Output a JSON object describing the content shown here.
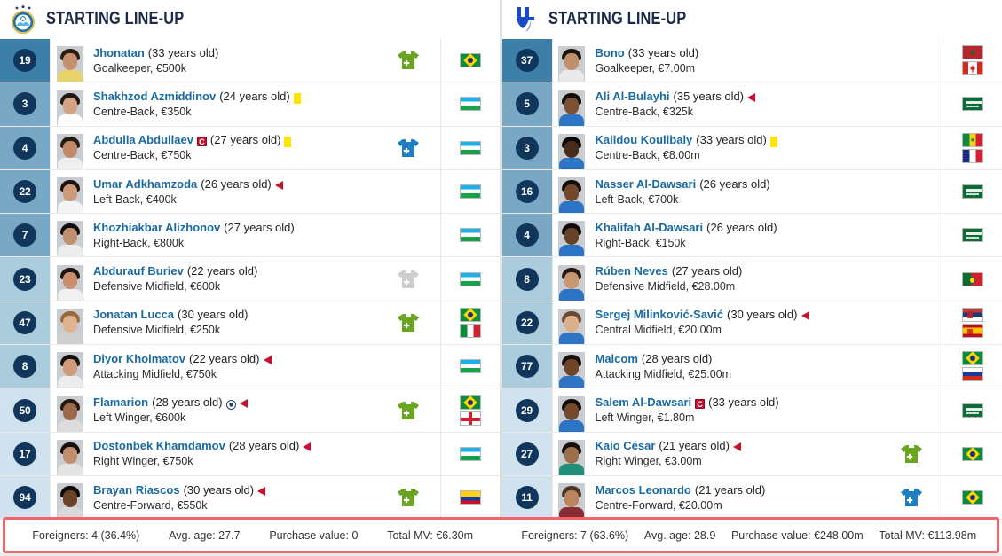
{
  "panels": [
    {
      "team_id": "pakhtakor",
      "logo": "pakhtakor-crest-icon",
      "title": "STARTING LINE-UP",
      "players": [
        {
          "number": "19",
          "name": "Jhonatan",
          "age": "(33 years old)",
          "position_value": "Goalkeeper, €500k",
          "captain": false,
          "yellow_card": false,
          "sub_off": false,
          "goal": false,
          "sub_icon": "sub-on-green",
          "flags": [
            "brazil"
          ],
          "tier": "gk",
          "photo": {
            "hair": "#2b1c12",
            "face": "#c79071",
            "body": "#e8d36a"
          }
        },
        {
          "number": "3",
          "name": "Shakhzod Azmiddinov",
          "age": "(24 years old)",
          "position_value": "Centre-Back, €350k",
          "captain": false,
          "yellow_card": true,
          "sub_off": false,
          "goal": false,
          "sub_icon": "none",
          "flags": [
            "uzbekistan"
          ],
          "tier": "def",
          "photo": {
            "hair": "#1d1611",
            "face": "#d4a184",
            "body": "#ffffff"
          }
        },
        {
          "number": "4",
          "name": "Abdulla Abdullaev",
          "age": "(27 years old)",
          "position_value": "Centre-Back, €750k",
          "captain": true,
          "yellow_card": true,
          "sub_off": false,
          "goal": false,
          "sub_icon": "sub-off-blue",
          "flags": [
            "uzbekistan"
          ],
          "tier": "def",
          "photo": {
            "hair": "#241a14",
            "face": "#c08a68",
            "body": "#efefef"
          }
        },
        {
          "number": "22",
          "name": "Umar Adkhamzoda",
          "age": "(26 years old)",
          "position_value": "Left-Back, €400k",
          "captain": false,
          "yellow_card": false,
          "sub_off": true,
          "goal": false,
          "sub_icon": "none",
          "flags": [
            "uzbekistan"
          ],
          "tier": "def",
          "photo": {
            "hair": "#191310",
            "face": "#cc9a79",
            "body": "#f4f4f4"
          }
        },
        {
          "number": "7",
          "name": "Khozhiakbar Alizhonov",
          "age": "(27 years old)",
          "position_value": "Right-Back, €800k",
          "captain": false,
          "yellow_card": false,
          "sub_off": false,
          "goal": false,
          "sub_icon": "none",
          "flags": [
            "uzbekistan"
          ],
          "tier": "def",
          "photo": {
            "hair": "#120d0a",
            "face": "#c08f6d",
            "body": "#ededed"
          }
        },
        {
          "number": "23",
          "name": "Abdurauf Buriev",
          "age": "(22 years old)",
          "position_value": "Defensive Midfield, €600k",
          "captain": false,
          "yellow_card": false,
          "sub_off": false,
          "goal": false,
          "sub_icon": "sub-on-grey",
          "flags": [
            "uzbekistan"
          ],
          "tier": "mid",
          "photo": {
            "hair": "#1b1410",
            "face": "#c98e6d",
            "body": "#f0f0f0"
          }
        },
        {
          "number": "47",
          "name": "Jonatan Lucca",
          "age": "(30 years old)",
          "position_value": "Defensive Midfield, €250k",
          "captain": false,
          "yellow_card": false,
          "sub_off": false,
          "goal": false,
          "sub_icon": "sub-on-green",
          "flags": [
            "brazil",
            "italy"
          ],
          "tier": "mid",
          "photo": {
            "hair": "#9a6a3a",
            "face": "#e0b291",
            "body": "#cfcfcf"
          }
        },
        {
          "number": "8",
          "name": "Diyor Kholmatov",
          "age": "(22 years old)",
          "position_value": "Attacking Midfield, €750k",
          "captain": false,
          "yellow_card": false,
          "sub_off": true,
          "goal": false,
          "sub_icon": "none",
          "flags": [
            "uzbekistan"
          ],
          "tier": "mid",
          "photo": {
            "hair": "#15100c",
            "face": "#cf9b7a",
            "body": "#ececec"
          }
        },
        {
          "number": "50",
          "name": "Flamarion",
          "age": "(28 years old)",
          "position_value": "Left Winger, €600k",
          "captain": false,
          "yellow_card": false,
          "sub_off": true,
          "goal": true,
          "sub_icon": "sub-on-green",
          "flags": [
            "brazil",
            "georgia"
          ],
          "tier": "att",
          "photo": {
            "hair": "#241710",
            "face": "#9a6a4a",
            "body": "#dcdcdc"
          }
        },
        {
          "number": "17",
          "name": "Dostonbek Khamdamov",
          "age": "(28 years old)",
          "position_value": "Right Winger, €750k",
          "captain": false,
          "yellow_card": false,
          "sub_off": true,
          "goal": false,
          "sub_icon": "none",
          "flags": [
            "uzbekistan"
          ],
          "tier": "att",
          "photo": {
            "hair": "#17110d",
            "face": "#c08e6d",
            "body": "#e4e4e4"
          }
        },
        {
          "number": "94",
          "name": "Brayan Riascos",
          "age": "(30 years old)",
          "position_value": "Centre-Forward, €550k",
          "captain": false,
          "yellow_card": false,
          "sub_off": true,
          "goal": false,
          "sub_icon": "sub-on-green",
          "flags": [
            "colombia"
          ],
          "tier": "att",
          "photo": {
            "hair": "#0d0906",
            "face": "#6a4228",
            "body": "#d8d8d8"
          }
        }
      ],
      "footer": {
        "foreigners": "Foreigners: 4 (36.4%)",
        "avg_age": "Avg. age: 27.7",
        "purchase_value": "Purchase value: 0",
        "total_mv": "Total MV: €6.30m"
      }
    },
    {
      "team_id": "al-hilal",
      "logo": "al-hilal-crest-icon",
      "title": "STARTING LINE-UP",
      "players": [
        {
          "number": "37",
          "name": "Bono",
          "age": "(33 years old)",
          "position_value": "Goalkeeper, €7.00m",
          "captain": false,
          "yellow_card": false,
          "sub_off": false,
          "goal": false,
          "sub_icon": "none",
          "flags": [
            "morocco",
            "canada"
          ],
          "tier": "gk",
          "photo": {
            "hair": "#1c140e",
            "face": "#c28f6c",
            "body": "#e9e9e9"
          }
        },
        {
          "number": "5",
          "name": "Ali Al-Bulayhi",
          "age": "(35 years old)",
          "position_value": "Centre-Back, €325k",
          "captain": false,
          "yellow_card": false,
          "sub_off": true,
          "goal": false,
          "sub_icon": "none",
          "flags": [
            "saudi-arabia"
          ],
          "tier": "def",
          "photo": {
            "hair": "#110c08",
            "face": "#7b5136",
            "body": "#2c74c6"
          }
        },
        {
          "number": "3",
          "name": "Kalidou Koulibaly",
          "age": "(33 years old)",
          "position_value": "Centre-Back, €8.00m",
          "captain": false,
          "yellow_card": true,
          "sub_off": false,
          "goal": false,
          "sub_icon": "none",
          "flags": [
            "senegal",
            "france"
          ],
          "tier": "def",
          "photo": {
            "hair": "#0a0705",
            "face": "#4a2c1a",
            "body": "#2c74c6"
          }
        },
        {
          "number": "16",
          "name": "Nasser Al-Dawsari",
          "age": "(26 years old)",
          "position_value": "Left-Back, €700k",
          "captain": false,
          "yellow_card": false,
          "sub_off": false,
          "goal": false,
          "sub_icon": "none",
          "flags": [
            "saudi-arabia"
          ],
          "tier": "def",
          "photo": {
            "hair": "#120c08",
            "face": "#70482c",
            "body": "#2c74c6"
          }
        },
        {
          "number": "4",
          "name": "Khalifah Al-Dawsari",
          "age": "(26 years old)",
          "position_value": "Right-Back, €150k",
          "captain": false,
          "yellow_card": false,
          "sub_off": false,
          "goal": false,
          "sub_icon": "none",
          "flags": [
            "saudi-arabia"
          ],
          "tier": "def",
          "photo": {
            "hair": "#0f0a07",
            "face": "#654228",
            "body": "#2c74c6"
          }
        },
        {
          "number": "8",
          "name": "Rúben Neves",
          "age": "(27 years old)",
          "position_value": "Defensive Midfield, €28.00m",
          "captain": false,
          "yellow_card": false,
          "sub_off": false,
          "goal": false,
          "sub_icon": "none",
          "flags": [
            "portugal"
          ],
          "tier": "mid",
          "photo": {
            "hair": "#241a12",
            "face": "#c9976f",
            "body": "#2c74c6"
          }
        },
        {
          "number": "22",
          "name": "Sergej Milinković-Savić",
          "age": "(30 years old)",
          "position_value": "Central Midfield, €20.00m",
          "captain": false,
          "yellow_card": false,
          "sub_off": true,
          "goal": false,
          "sub_icon": "none",
          "flags": [
            "serbia",
            "spain"
          ],
          "tier": "mid",
          "photo": {
            "hair": "#6a4a2e",
            "face": "#dcb08c",
            "body": "#2c74c6"
          }
        },
        {
          "number": "77",
          "name": "Malcom",
          "age": "(28 years old)",
          "position_value": "Attacking Midfield, €25.00m",
          "captain": false,
          "yellow_card": false,
          "sub_off": false,
          "goal": false,
          "sub_icon": "none",
          "flags": [
            "brazil",
            "russia"
          ],
          "tier": "mid",
          "photo": {
            "hair": "#140e09",
            "face": "#6e4528",
            "body": "#2c74c6"
          }
        },
        {
          "number": "29",
          "name": "Salem Al-Dawsari",
          "age": "(33 years old)",
          "position_value": "Left Winger, €1.80m",
          "captain": true,
          "yellow_card": false,
          "sub_off": false,
          "goal": false,
          "sub_icon": "none",
          "flags": [
            "saudi-arabia"
          ],
          "tier": "att",
          "photo": {
            "hair": "#120c08",
            "face": "#74492c",
            "body": "#2c74c6"
          }
        },
        {
          "number": "27",
          "name": "Kaio César",
          "age": "(21 years old)",
          "position_value": "Right Winger, €3.00m",
          "captain": false,
          "yellow_card": false,
          "sub_off": true,
          "goal": false,
          "sub_icon": "sub-on-green",
          "flags": [
            "brazil"
          ],
          "tier": "att",
          "photo": {
            "hair": "#171009",
            "face": "#9b6f4c",
            "body": "#1f8f7a"
          }
        },
        {
          "number": "11",
          "name": "Marcos Leonardo",
          "age": "(21 years old)",
          "position_value": "Centre-Forward, €20.00m",
          "captain": false,
          "yellow_card": false,
          "sub_off": false,
          "goal": false,
          "sub_icon": "sub-off-blue",
          "flags": [
            "brazil"
          ],
          "tier": "att",
          "photo": {
            "hair": "#4a3520",
            "face": "#b8855e",
            "body": "#8a2c34"
          }
        }
      ],
      "footer": {
        "foreigners": "Foreigners: 7 (63.6%)",
        "avg_age": "Avg. age: 28.9",
        "purchase_value": "Purchase value: €248.00m",
        "total_mv": "Total MV: €113.98m"
      }
    }
  ],
  "colors": {
    "tier_gk": "#3c7fa8",
    "tier_def": "#78a8c4",
    "tier_mid": "#aaccdd",
    "tier_att": "#cfe2ed",
    "name_link": "#1a6aa2",
    "number_badge": "#10365c",
    "sub_on_green": "#6aa521",
    "sub_off_blue": "#1e7fc0",
    "sub_grey": "#cdcdcd",
    "footer_border": "#f2636c",
    "card_yellow": "#ffe400",
    "arrow_red": "#c8102e"
  }
}
